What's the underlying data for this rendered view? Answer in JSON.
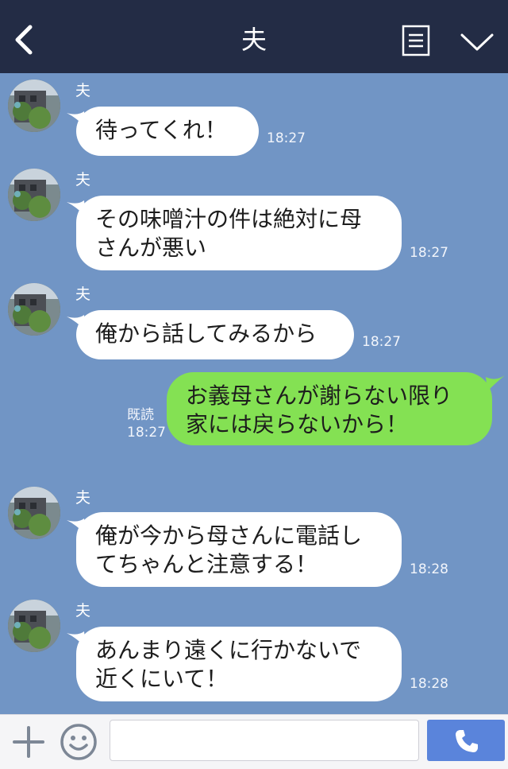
{
  "header": {
    "title": "夫",
    "back_icon": "chevron-left-icon",
    "notes_icon": "notes-list-icon",
    "menu_icon": "chevron-down-icon"
  },
  "messages": [
    {
      "sender": "夫",
      "text": "待ってくれ！",
      "time": "18:27"
    },
    {
      "sender": "夫",
      "text": "その味噌汁の件は絶対に母\nさんが悪い",
      "time": "18:27"
    },
    {
      "sender": "夫",
      "text": "俺から話してみるから",
      "time": "18:27"
    },
    {
      "text": "お義母さんが謝らない限り\n家には戻らないから！",
      "read": "既読",
      "time": "18:27"
    },
    {
      "sender": "夫",
      "text": "俺が今から母さんに電話し\nてちゃんと注意する！",
      "time": "18:28"
    },
    {
      "sender": "夫",
      "text": "あんまり遠くに行かないで\n近くにいて！",
      "time": "18:28"
    }
  ],
  "input_bar": {
    "add_icon": "plus-icon",
    "sticker_icon": "smiley-icon",
    "placeholder": "",
    "call_icon": "phone-icon"
  },
  "colors": {
    "header_bg": "#232c45",
    "chat_bg": "#7195c5",
    "incoming_bubble": "#ffffff",
    "outgoing_bubble": "#84e153",
    "call_button": "#5a84db"
  }
}
